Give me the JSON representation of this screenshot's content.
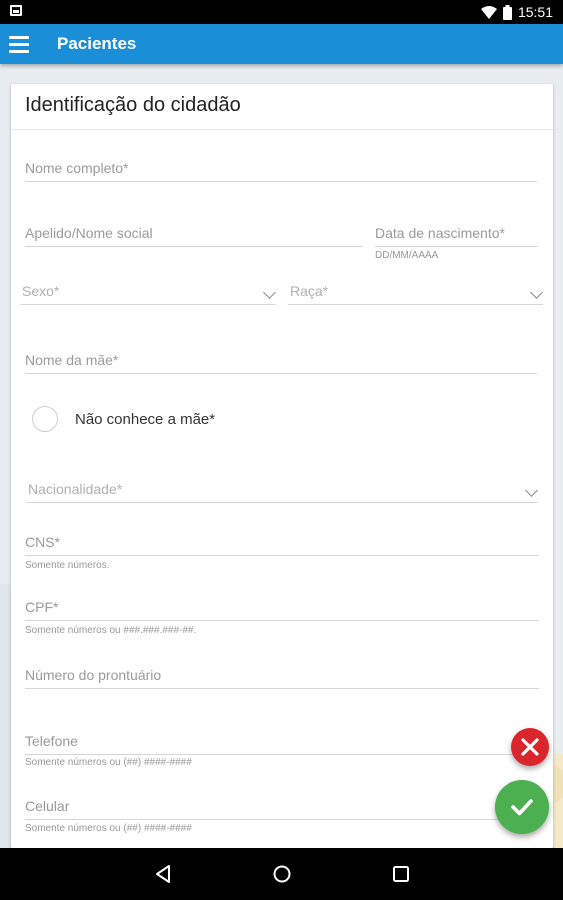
{
  "status_bar": {
    "time": "15:51",
    "icons": [
      "screenshot-icon",
      "wifi-icon",
      "battery-icon"
    ]
  },
  "app_bar": {
    "title": "Pacientes",
    "menu_icon": "menu-icon"
  },
  "form": {
    "title": "Identificação do cidadão",
    "nome_completo": "Nome completo*",
    "apelido": "Apelido/Nome social",
    "data_nascimento": "Data de nascimento*",
    "data_nascimento_hint": "DD/MM/AAAA",
    "sexo": "Sexo*",
    "raca": "Raça*",
    "nome_mae": "Nome da mãe*",
    "nao_conhece_mae": "Não conhece a mãe*",
    "nacionalidade": "Nacionalidade*",
    "cns": "CNS*",
    "cns_hint": "Somente números.",
    "cpf": "CPF*",
    "cpf_hint": "Somente números ou ###.###.###-##.",
    "prontuario": "Número do prontuário",
    "telefone": "Telefone",
    "telefone_hint": "Somente números ou (##) ####-####",
    "celular": "Celular",
    "celular_hint": "Somente números ou (##) ####-####"
  },
  "actions": {
    "cancel_icon": "close-icon",
    "confirm_icon": "check-icon"
  },
  "nav_bar": {
    "icons": [
      "back-icon",
      "home-icon",
      "recents-icon"
    ]
  },
  "colors": {
    "app_bar": "#1a8fd8",
    "cancel": "#d9262c",
    "confirm": "#4caf50"
  }
}
